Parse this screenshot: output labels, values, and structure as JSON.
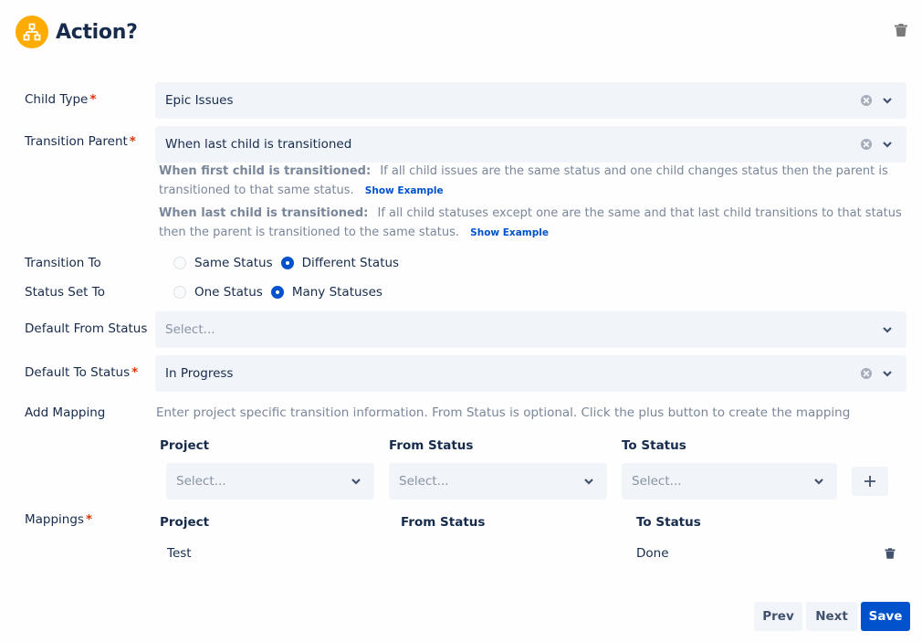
{
  "header": {
    "title": "Action?",
    "logo_icon": "hierarchy-icon",
    "delete_icon": "trash-icon"
  },
  "form": {
    "child_type": {
      "label": "Child Type",
      "required": "*",
      "value": "Epic Issues"
    },
    "transition_parent": {
      "label": "Transition Parent",
      "required": "*",
      "value": "When last child is transitioned"
    },
    "help": {
      "first": {
        "title": "When first child is transitioned:",
        "text": "If all child issues are the same status and one child changes status then the parent is transitioned to that same status.",
        "link": "Show Example"
      },
      "last": {
        "title": "When last child is transitioned:",
        "text": "If all child statuses except one are the same and that last child transitions to that status then the parent is transitioned to the same status.",
        "link": "Show Example"
      }
    },
    "transition_to": {
      "label": "Transition To",
      "options": [
        "Same Status",
        "Different Status"
      ],
      "selected": "Different Status"
    },
    "status_set_to": {
      "label": "Status Set To",
      "options": [
        "One Status",
        "Many Statuses"
      ],
      "selected": "Many Statuses"
    },
    "default_from_status": {
      "label": "Default From Status",
      "placeholder": "Select..."
    },
    "default_to_status": {
      "label": "Default To Status",
      "required": "*",
      "value": "In Progress"
    },
    "add_mapping": {
      "label": "Add Mapping",
      "help": "Enter project specific transition information. From Status is optional. Click the plus button to create the mapping",
      "columns": [
        "Project",
        "From Status",
        "To Status"
      ],
      "placeholders": [
        "Select...",
        "Select...",
        "Select..."
      ],
      "plus_label": "+"
    },
    "mappings": {
      "label": "Mappings",
      "required": "*",
      "columns": [
        "Project",
        "From Status",
        "To Status"
      ],
      "rows": [
        {
          "project": "Test",
          "from_status": "",
          "to_status": "Done"
        }
      ]
    }
  },
  "footer": {
    "prev": "Prev",
    "next": "Next",
    "save": "Save"
  },
  "colors": {
    "accent": "#0052cc",
    "logo": "#ffab00",
    "required": "#de350b",
    "field_bg": "#f1f4f8"
  }
}
